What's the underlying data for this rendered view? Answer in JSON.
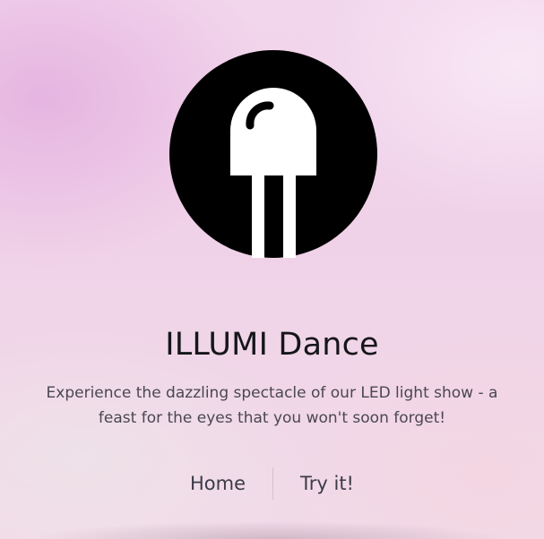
{
  "brand": {
    "logo_icon": "led-bulb-icon",
    "title": "ILLUMI Dance"
  },
  "hero": {
    "description": "Experience the dazzling spectacle of our LED light show - a feast for the eyes that you won't soon forget!"
  },
  "nav": {
    "items": [
      {
        "label": "Home"
      },
      {
        "label": "Try it!"
      }
    ]
  },
  "colors": {
    "logo_fill": "#000000",
    "logo_cutout": "#ffffff",
    "title": "#16161a",
    "text": "#4a4752",
    "nav_text": "#3c3b48"
  }
}
